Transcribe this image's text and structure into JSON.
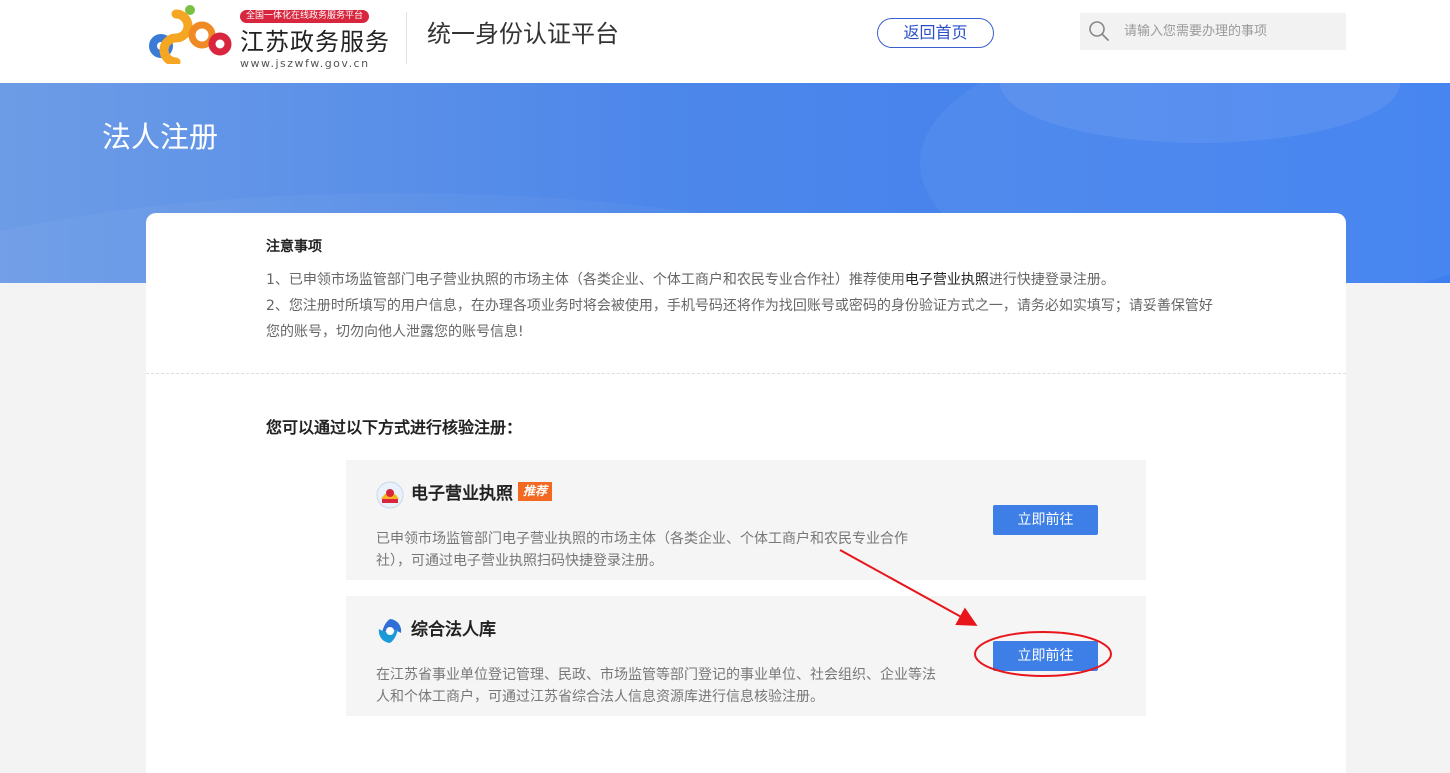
{
  "header": {
    "logo_badge": "全国一体化在线政务服务平台",
    "logo_name": "江苏政务服务",
    "logo_url": "www.jszwfw.gov.cn",
    "platform_title": "统一身份认证平台",
    "home_button": "返回首页",
    "search_placeholder": "请输入您需要办理的事项"
  },
  "banner": {
    "title": "法人注册"
  },
  "notice": {
    "title": "注意事项",
    "item1_before": "1、已申领市场监管部门电子营业执照的市场主体（各类企业、个体工商户和农民专业合作社）推荐使用",
    "item1_highlight": "电子营业执照",
    "item1_after": "进行快捷登录注册。",
    "item2": "2、您注册时所填写的用户信息，在办理各项业务时将会被使用，手机号码还将作为找回账号或密码的身份验证方式之一，请务必如实填写；请妥善保管好您的账号，切勿向他人泄露您的账号信息!"
  },
  "methods": {
    "title": "您可以通过以下方式进行核验注册：",
    "items": [
      {
        "name": "电子营业执照",
        "badge": "推荐",
        "icon": "emblem-icon",
        "description": "已申领市场监管部门电子营业执照的市场主体（各类企业、个体工商户和农民专业合作社），可通过电子营业执照扫码快捷登录注册。",
        "button": "立即前往"
      },
      {
        "name": "综合法人库",
        "icon": "legal-person-db-icon",
        "description": "在江苏省事业单位登记管理、民政、市场监管等部门登记的事业单位、社会组织、企业等法人和个体工商户，可通过江苏省综合法人信息资源库进行信息核验注册。",
        "button": "立即前往"
      }
    ]
  },
  "colors": {
    "primary": "#3d7fe6",
    "badge": "#f26a21",
    "annotation": "#e8161b"
  }
}
